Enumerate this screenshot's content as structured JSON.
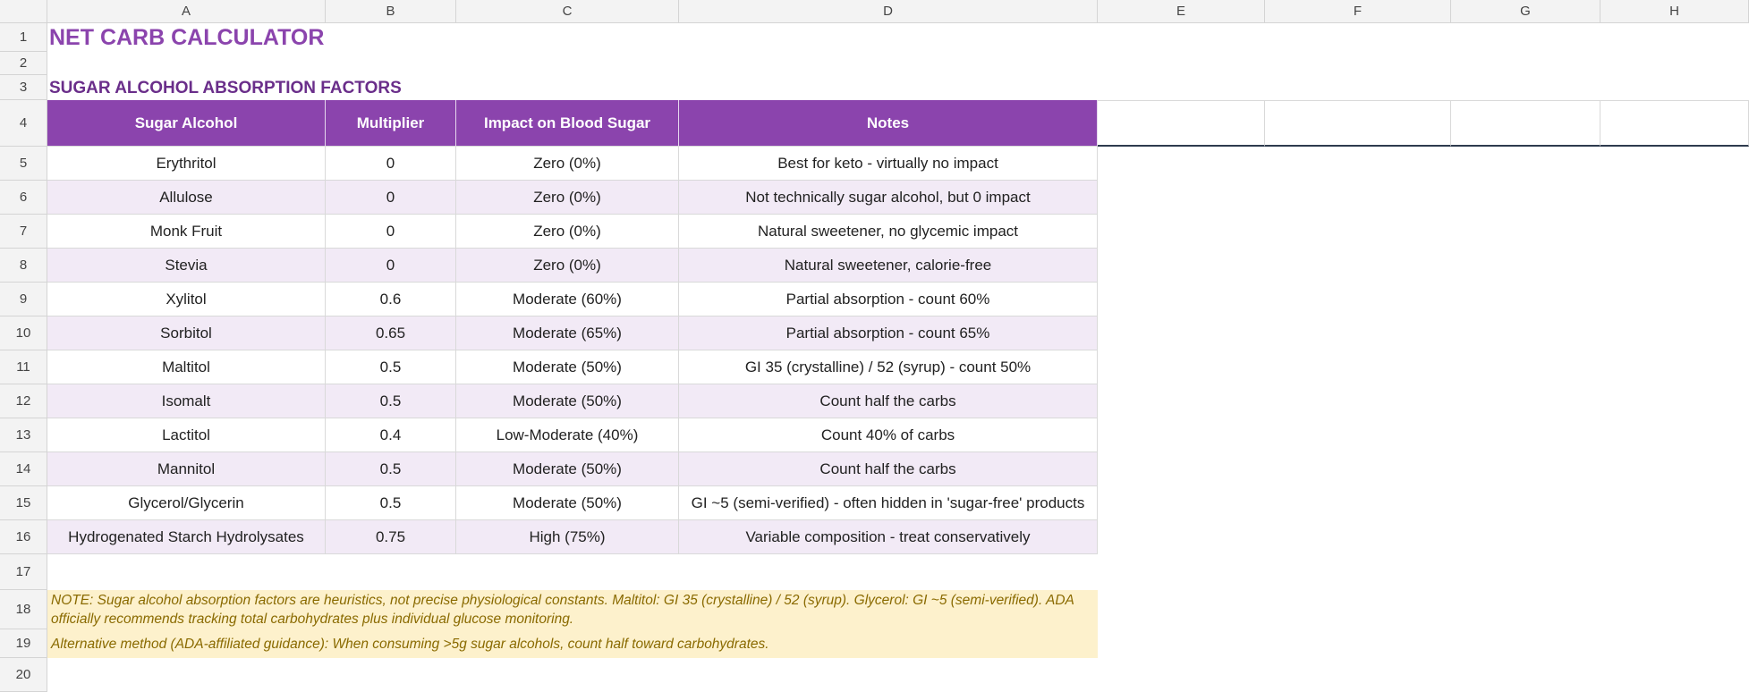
{
  "columns": [
    "A",
    "B",
    "C",
    "D",
    "E",
    "F",
    "G",
    "H"
  ],
  "rows": [
    "1",
    "2",
    "3",
    "4",
    "5",
    "6",
    "7",
    "8",
    "9",
    "10",
    "11",
    "12",
    "13",
    "14",
    "15",
    "16",
    "17",
    "18",
    "19",
    "20"
  ],
  "title": "NET CARB CALCULATOR",
  "subtitle": "SUGAR ALCOHOL ABSORPTION FACTORS",
  "table": {
    "headers": [
      "Sugar Alcohol",
      "Multiplier",
      "Impact on Blood Sugar",
      "Notes"
    ],
    "rows": [
      [
        "Erythritol",
        "0",
        "Zero (0%)",
        "Best for keto - virtually no impact"
      ],
      [
        "Allulose",
        "0",
        "Zero (0%)",
        "Not technically sugar alcohol, but 0 impact"
      ],
      [
        "Monk Fruit",
        "0",
        "Zero (0%)",
        "Natural sweetener, no glycemic impact"
      ],
      [
        "Stevia",
        "0",
        "Zero (0%)",
        "Natural sweetener, calorie-free"
      ],
      [
        "Xylitol",
        "0.6",
        "Moderate (60%)",
        "Partial absorption - count 60%"
      ],
      [
        "Sorbitol",
        "0.65",
        "Moderate (65%)",
        "Partial absorption - count 65%"
      ],
      [
        "Maltitol",
        "0.5",
        "Moderate (50%)",
        "GI 35 (crystalline) / 52 (syrup) - count 50%"
      ],
      [
        "Isomalt",
        "0.5",
        "Moderate (50%)",
        "Count half the carbs"
      ],
      [
        "Lactitol",
        "0.4",
        "Low-Moderate (40%)",
        "Count 40% of carbs"
      ],
      [
        "Mannitol",
        "0.5",
        "Moderate (50%)",
        "Count half the carbs"
      ],
      [
        "Glycerol/Glycerin",
        "0.5",
        "Moderate (50%)",
        "GI ~5 (semi-verified) - often hidden in 'sugar-free' products"
      ],
      [
        "Hydrogenated Starch Hydrolysates",
        "0.75",
        "High (75%)",
        "Variable composition - treat conservatively"
      ]
    ]
  },
  "note1": "NOTE: Sugar alcohol absorption factors are heuristics, not precise physiological constants. Maltitol: GI 35 (crystalline) / 52 (syrup). Glycerol: GI ~5 (semi-verified). ADA officially recommends tracking total carbohydrates plus individual glucose monitoring.",
  "note2": "Alternative method (ADA-affiliated guidance): When consuming >5g sugar alcohols, count half toward carbohydrates.",
  "colors": {
    "header_bg": "#8b44ad",
    "alt_row": "#f2eaf6",
    "note_bg": "#fdf1cc",
    "title": "#8b44ad"
  }
}
